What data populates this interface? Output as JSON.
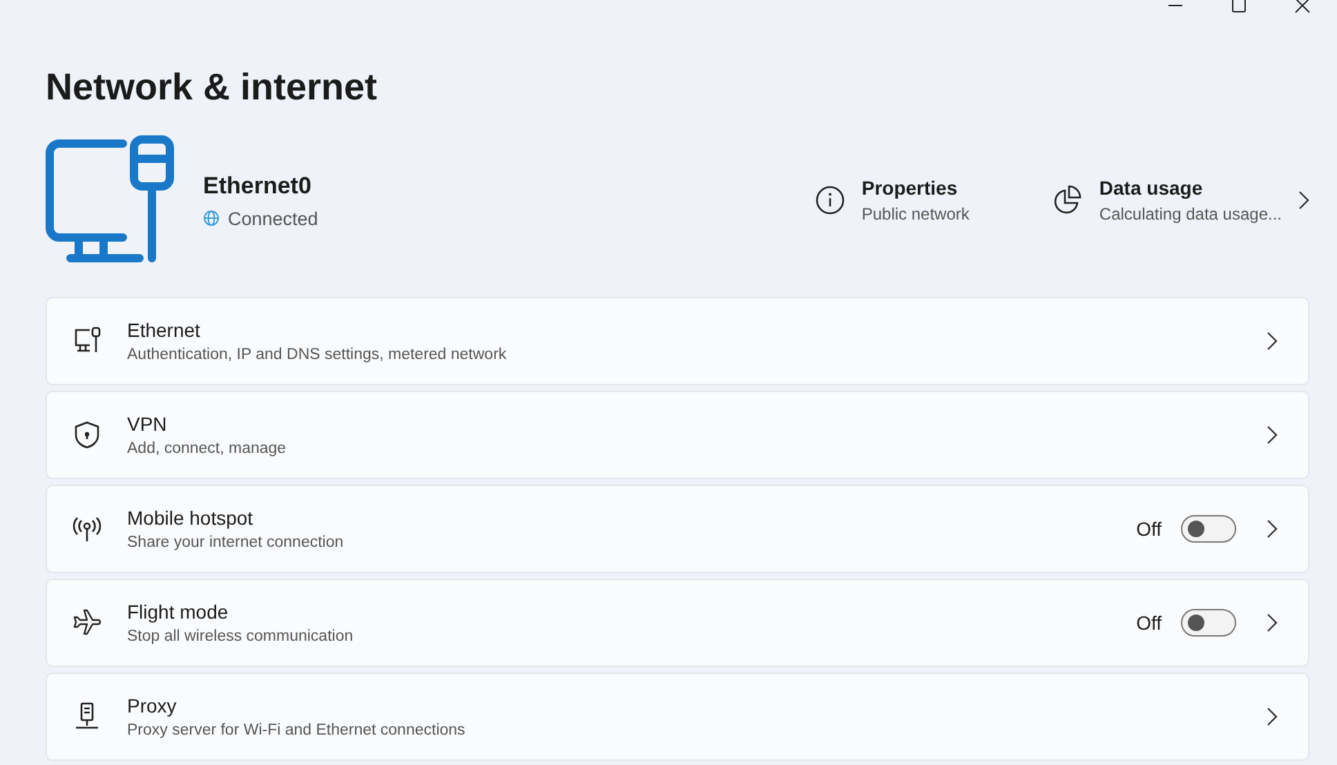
{
  "window": {
    "title": "Network & internet"
  },
  "connection": {
    "name": "Ethernet0",
    "status": "Connected"
  },
  "summary": [
    {
      "kind": "properties",
      "title": "Properties",
      "subtitle": "Public network"
    },
    {
      "kind": "usage",
      "title": "Data usage",
      "subtitle": "Calculating data usage..."
    }
  ],
  "items": [
    {
      "kind": "link",
      "title": "Ethernet",
      "subtitle": "Authentication, IP and DNS settings, metered network"
    },
    {
      "kind": "link",
      "title": "VPN",
      "subtitle": "Add, connect, manage"
    },
    {
      "kind": "toggle",
      "title": "Mobile hotspot",
      "subtitle": "Share your internet connection",
      "state_label": "Off",
      "on": false
    },
    {
      "kind": "toggle",
      "title": "Flight mode",
      "subtitle": "Stop all wireless communication",
      "state_label": "Off",
      "on": false
    },
    {
      "kind": "link",
      "title": "Proxy",
      "subtitle": "Proxy server for Wi-Fi and Ethernet connections"
    }
  ]
}
